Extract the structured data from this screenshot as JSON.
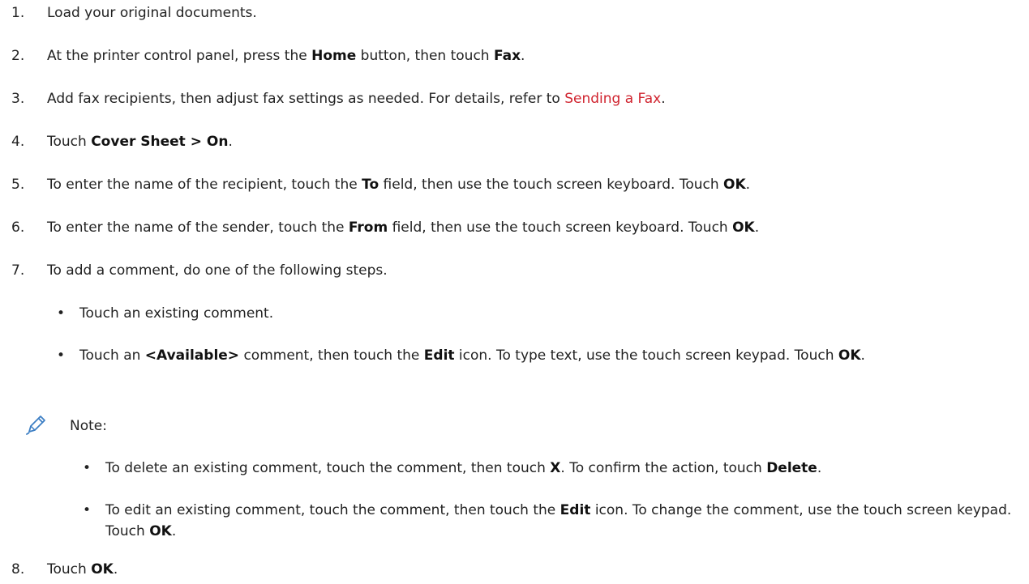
{
  "steps": [
    {
      "num": "1.",
      "parts": [
        {
          "t": "Load your original documents."
        }
      ]
    },
    {
      "num": "2.",
      "parts": [
        {
          "t": "At the printer control panel, press the "
        },
        {
          "t": "Home",
          "b": true
        },
        {
          "t": " button, then touch "
        },
        {
          "t": "Fax",
          "b": true
        },
        {
          "t": "."
        }
      ]
    },
    {
      "num": "3.",
      "parts": [
        {
          "t": "Add fax recipients, then adjust fax settings as needed. For details, refer to "
        },
        {
          "t": "Sending a Fax",
          "link": true
        },
        {
          "t": "."
        }
      ]
    },
    {
      "num": "4.",
      "parts": [
        {
          "t": "Touch "
        },
        {
          "t": "Cover Sheet > On",
          "b": true
        },
        {
          "t": "."
        }
      ]
    },
    {
      "num": "5.",
      "parts": [
        {
          "t": "To enter the name of the recipient, touch the "
        },
        {
          "t": "To",
          "b": true
        },
        {
          "t": " field, then use the touch screen keyboard. Touch "
        },
        {
          "t": "OK",
          "b": true
        },
        {
          "t": "."
        }
      ]
    },
    {
      "num": "6.",
      "parts": [
        {
          "t": "To enter the name of the sender, touch the "
        },
        {
          "t": "From",
          "b": true
        },
        {
          "t": " field, then use the touch screen keyboard. Touch "
        },
        {
          "t": "OK",
          "b": true
        },
        {
          "t": "."
        }
      ]
    },
    {
      "num": "7.",
      "parts": [
        {
          "t": "To add a comment, do one of the following steps."
        }
      ]
    },
    {
      "num": "8.",
      "parts": [
        {
          "t": "Touch "
        },
        {
          "t": "OK",
          "b": true
        },
        {
          "t": "."
        }
      ]
    }
  ],
  "comment_options": [
    {
      "parts": [
        {
          "t": "Touch an existing comment."
        }
      ]
    },
    {
      "parts": [
        {
          "t": "Touch an "
        },
        {
          "t": "<Available>",
          "b": true
        },
        {
          "t": " comment, then touch the "
        },
        {
          "t": "Edit",
          "b": true
        },
        {
          "t": " icon. To type text, use the touch screen keypad. Touch "
        },
        {
          "t": "OK",
          "b": true
        },
        {
          "t": "."
        }
      ]
    }
  ],
  "note": {
    "icon": "pencil-icon",
    "label": "Note:",
    "items": [
      {
        "parts": [
          {
            "t": "To delete an existing comment, touch the comment, then touch "
          },
          {
            "t": "X",
            "b": true
          },
          {
            "t": ". To confirm the action, touch "
          },
          {
            "t": "Delete",
            "b": true
          },
          {
            "t": "."
          }
        ]
      },
      {
        "parts": [
          {
            "t": "To edit an existing comment, touch the comment, then touch the "
          },
          {
            "t": "Edit",
            "b": true
          },
          {
            "t": " icon. To change the comment, use the touch screen keypad. Touch "
          },
          {
            "t": "OK",
            "b": true
          },
          {
            "t": "."
          }
        ]
      }
    ]
  },
  "colors": {
    "text": "#222222",
    "link": "#d0242f",
    "icon": "#3d7fc4"
  }
}
